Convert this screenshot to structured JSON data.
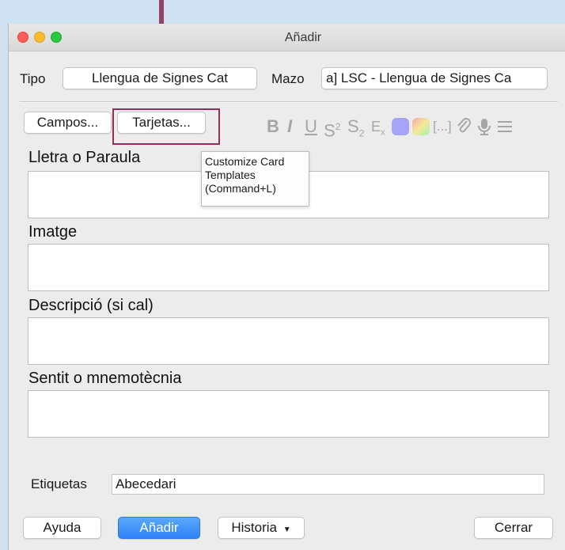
{
  "window": {
    "title": "Añadir"
  },
  "top_row": {
    "tipo_label": "Tipo",
    "tipo_value": "Llengua de Signes Cat",
    "mazo_label": "Mazo",
    "mazo_value": "a] LSC - Llengua de Signes Ca"
  },
  "toolbar": {
    "campos_label": "Campos...",
    "tarjetas_label": "Tarjetas...",
    "format_icons": [
      "bold-icon",
      "italic-icon",
      "underline-icon",
      "superscript-icon",
      "subscript-icon",
      "clear-format-icon",
      "text-color-icon",
      "highlight-color-icon",
      "cloze-icon",
      "attach-icon",
      "record-audio-icon",
      "more-icon"
    ]
  },
  "tooltip": {
    "line1": "Customize Card",
    "line2": "Templates",
    "line3": "(Command+L)"
  },
  "fields": [
    {
      "label": "Lletra o Paraula",
      "value": ""
    },
    {
      "label": "Imatge",
      "value": ""
    },
    {
      "label": "Descripció (si cal)",
      "value": ""
    },
    {
      "label": "Sentit o mnemotècnia",
      "value": ""
    }
  ],
  "tags": {
    "label": "Etiquetas",
    "value": "Abecedari"
  },
  "buttons": {
    "help": "Ayuda",
    "add": "Añadir",
    "history": "Historia",
    "close": "Cerrar"
  },
  "colors": {
    "annotation": "#914466",
    "primary": "#2f83f6",
    "text_color_swatch": "#a7a3f8"
  }
}
